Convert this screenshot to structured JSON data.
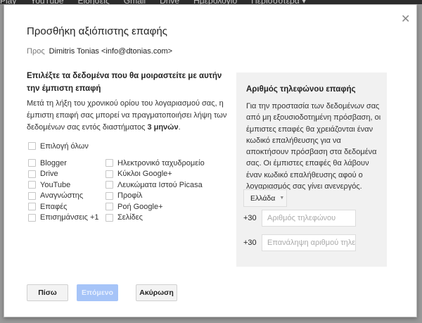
{
  "topbar": {
    "items": [
      "Play",
      "YouTube",
      "Ειδήσεις",
      "Gmail",
      "Drive",
      "Ημερολόγιο",
      "Περισσότερα ▾"
    ]
  },
  "dialog": {
    "title": "Προσθήκη αξιόπιστης επαφής",
    "to_label": "Προς",
    "to_value": "Dimitris Tonias <info@dtonias.com>",
    "heading": "Επιλέξτε τα δεδομένα που θα μοιραστείτε με αυτήν την έμπιστη επαφή",
    "para_text": "Μετά τη λήξη του χρονικού ορίου του λογαριασμού σας, η έμπιστη επαφή σας μπορεί να πραγματοποιήσει λήψη των δεδομένων σας εντός διαστήματος ",
    "para_bold": "3 μηνών",
    "para_end": ".",
    "select_all": "Επιλογή όλων",
    "col1": [
      "Blogger",
      "Drive",
      "YouTube",
      "Αναγνώστης",
      "Επαφές",
      "Επισημάνσεις +1"
    ],
    "col2": [
      "Ηλεκτρονικό ταχυδρομείο",
      "Κύκλοι Google+",
      "Λευκώματα Ιστού Picasa",
      "Προφίλ",
      "Ροή Google+",
      "Σελίδες"
    ],
    "panel": {
      "title": "Αριθμός τηλεφώνου επαφής",
      "text": "Για την προστασία των δεδομένων σας από μη εξουσιοδοτημένη πρόσβαση, οι έμπιστες επαφές θα χρειάζονται έναν κωδικό επαλήθευσης για να αποκτήσουν πρόσβαση στα δεδομένα σας. Οι έμπιστες επαφές θα λάβουν έναν κωδικό επαλήθευσης αφού ο λογαριασμός σας γίνει ανενεργός.",
      "country": "Ελλάδα",
      "code": "+30",
      "phone_placeholder": "Αριθμός τηλεφώνου",
      "phone_repeat_placeholder": "Επανάληψη αριθμού τηλεφώνου"
    },
    "buttons": {
      "back": "Πίσω",
      "next": "Επόμενο",
      "cancel": "Ακύρωση"
    },
    "colors": {
      "next_disabled": "#a6c4f8",
      "panel_bg": "#f1f1f1"
    }
  }
}
